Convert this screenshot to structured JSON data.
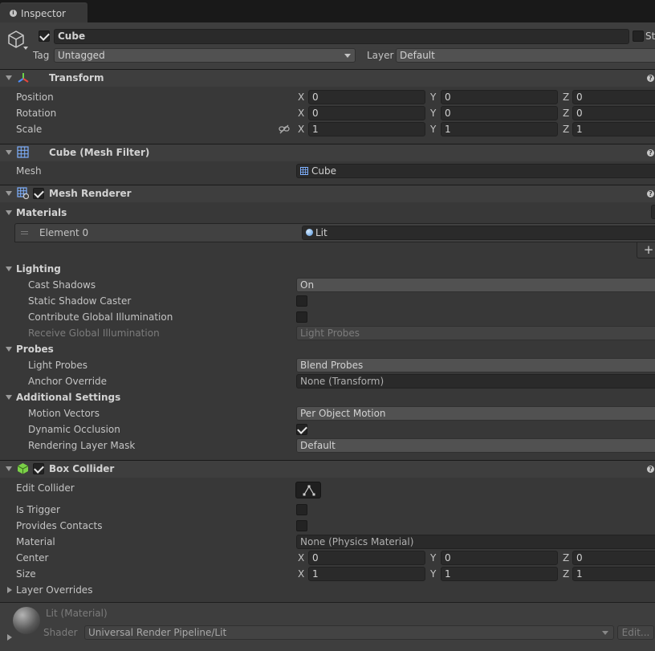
{
  "tab": {
    "title": "Inspector"
  },
  "object": {
    "name": "Cube",
    "static_label": "St",
    "tag_label": "Tag",
    "tag_value": "Untagged",
    "layer_label": "Layer",
    "layer_value": "Default"
  },
  "transform": {
    "title": "Transform",
    "rows": [
      {
        "label": "Position",
        "x": "0",
        "y": "0",
        "z": "0"
      },
      {
        "label": "Rotation",
        "x": "0",
        "y": "0",
        "z": "0"
      },
      {
        "label": "Scale",
        "x": "1",
        "y": "1",
        "z": "1"
      }
    ]
  },
  "axes": {
    "x": "X",
    "y": "Y",
    "z": "Z"
  },
  "mesh_filter": {
    "title": "Cube (Mesh Filter)",
    "mesh_label": "Mesh",
    "mesh_value": "Cube"
  },
  "mesh_renderer": {
    "title": "Mesh Renderer",
    "materials_label": "Materials",
    "element_label": "Element 0",
    "element_value": "Lit",
    "plus": "+",
    "lighting_label": "Lighting",
    "cast_shadows_label": "Cast Shadows",
    "cast_shadows_value": "On",
    "static_shadow_label": "Static Shadow Caster",
    "contribute_gi_label": "Contribute Global Illumination",
    "receive_gi_label": "Receive Global Illumination",
    "receive_gi_value": "Light Probes",
    "probes_label": "Probes",
    "light_probes_label": "Light Probes",
    "light_probes_value": "Blend Probes",
    "anchor_override_label": "Anchor Override",
    "anchor_override_value": "None (Transform)",
    "additional_label": "Additional Settings",
    "motion_vectors_label": "Motion Vectors",
    "motion_vectors_value": "Per Object Motion",
    "dynamic_occlusion_label": "Dynamic Occlusion",
    "rendering_layer_label": "Rendering Layer Mask",
    "rendering_layer_value": "Default"
  },
  "box_collider": {
    "title": "Box Collider",
    "edit_collider_label": "Edit Collider",
    "is_trigger_label": "Is Trigger",
    "provides_contacts_label": "Provides Contacts",
    "material_label": "Material",
    "material_value": "None (Physics Material)",
    "center_label": "Center",
    "center": {
      "x": "0",
      "y": "0",
      "z": "0"
    },
    "size_label": "Size",
    "size": {
      "x": "1",
      "y": "1",
      "z": "1"
    },
    "layer_overrides_label": "Layer Overrides"
  },
  "material": {
    "name": "Lit (Material)",
    "shader_label": "Shader",
    "shader_value": "Universal Render Pipeline/Lit",
    "edit_label": "Edit..."
  },
  "colors": {
    "background": "#383838",
    "header": "#3e3e3e",
    "field": "#2a2a2a",
    "accent": "#4c7fff"
  }
}
